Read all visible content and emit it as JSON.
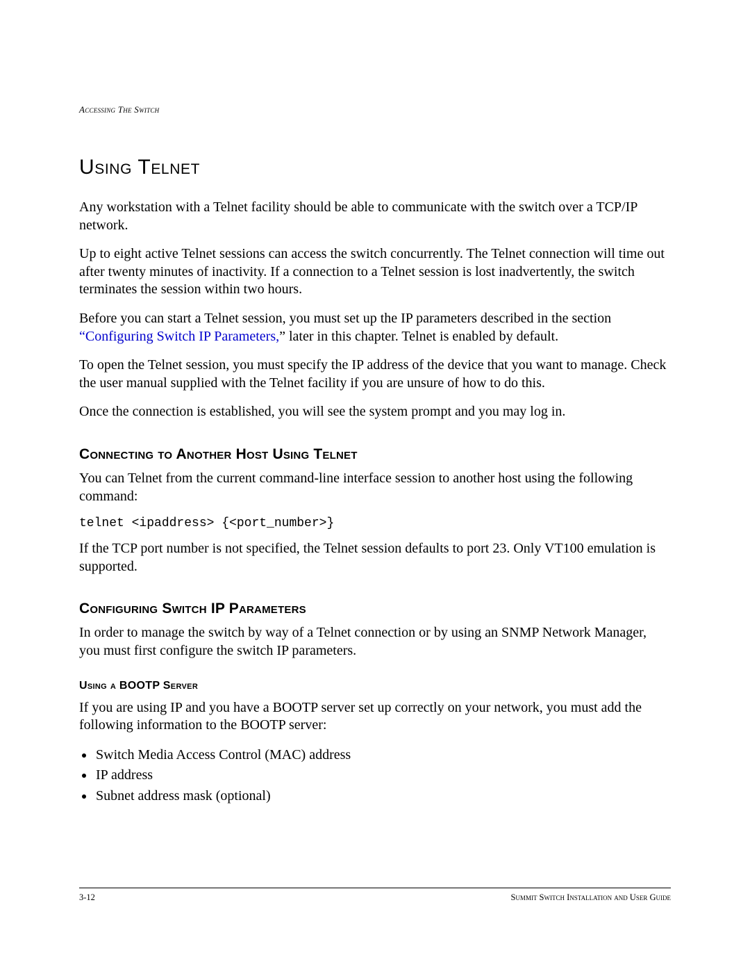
{
  "header": {
    "running": "Accessing The Switch"
  },
  "h1": "Using Telnet",
  "para1": "Any workstation with a Telnet facility should be able to communicate with the switch over a TCP/IP network.",
  "para2": "Up to eight active Telnet sessions can access the switch concurrently. The Telnet connection will time out after twenty minutes of inactivity. If a connection to a Telnet session is lost inadvertently, the switch terminates the session within two hours.",
  "para3a": "Before you can start a Telnet session, you must set up the IP parameters described in the section ",
  "para3_link": "“Configuring Switch IP Parameters,",
  "para3b": "” later in this chapter. Telnet is enabled by default.",
  "para4": "To open the Telnet session, you must specify the IP address of the device that you want to manage. Check the user manual supplied with the Telnet facility if you are unsure of how to do this.",
  "para5": "Once the connection is established, you will see the system prompt and you may log in.",
  "h2a": "Connecting to Another Host Using Telnet",
  "para6": "You can Telnet from the current command-line interface session to another host using the following command:",
  "code1": "telnet <ipaddress> {<port_number>}",
  "para7": "If the TCP port number is not specified, the Telnet session defaults to port 23. Only VT100 emulation is supported.",
  "h2b": "Configuring Switch IP Parameters",
  "para8": "In order to manage the switch by way of a Telnet connection or by using an SNMP Network Manager, you must first configure the switch IP parameters.",
  "h3a": "Using a BOOTP Server",
  "para9": "If you are using IP and you have a BOOTP server set up correctly on your network, you must add the following information to the BOOTP server:",
  "bullets": {
    "b1": "Switch Media Access Control (MAC) address",
    "b2": "IP address",
    "b3": "Subnet address mask (optional)"
  },
  "footer": {
    "page": "3-12",
    "guide": "Summit Switch Installation and User Guide"
  }
}
